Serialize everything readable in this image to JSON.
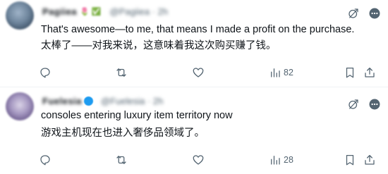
{
  "tweets": [
    {
      "author_name": "Pagiiea",
      "author_badge": "🌷 ✅",
      "author_handle": "@Pagiiea · 2h",
      "text_en": "That's awesome—to me, that means I made a profit on the purchase.",
      "text_zh": "太棒了——对我来说，这意味着我这次购买赚了钱。",
      "views": "82"
    },
    {
      "author_name": "Fuelesia",
      "author_handle": "@Fuelesia · 2h",
      "text_en": "consoles entering luxury item territory now",
      "text_zh": "游戏主机现在也进入奢侈品领域了。",
      "views": "28"
    }
  ],
  "icons": [
    "mute-icon",
    "more-icon",
    "reply-icon",
    "retweet-icon",
    "like-icon",
    "views-icon",
    "bookmark-icon",
    "share-icon"
  ],
  "colors": {
    "muted": "#536471",
    "text": "#0f1419",
    "verified": "#1d9bf0"
  }
}
